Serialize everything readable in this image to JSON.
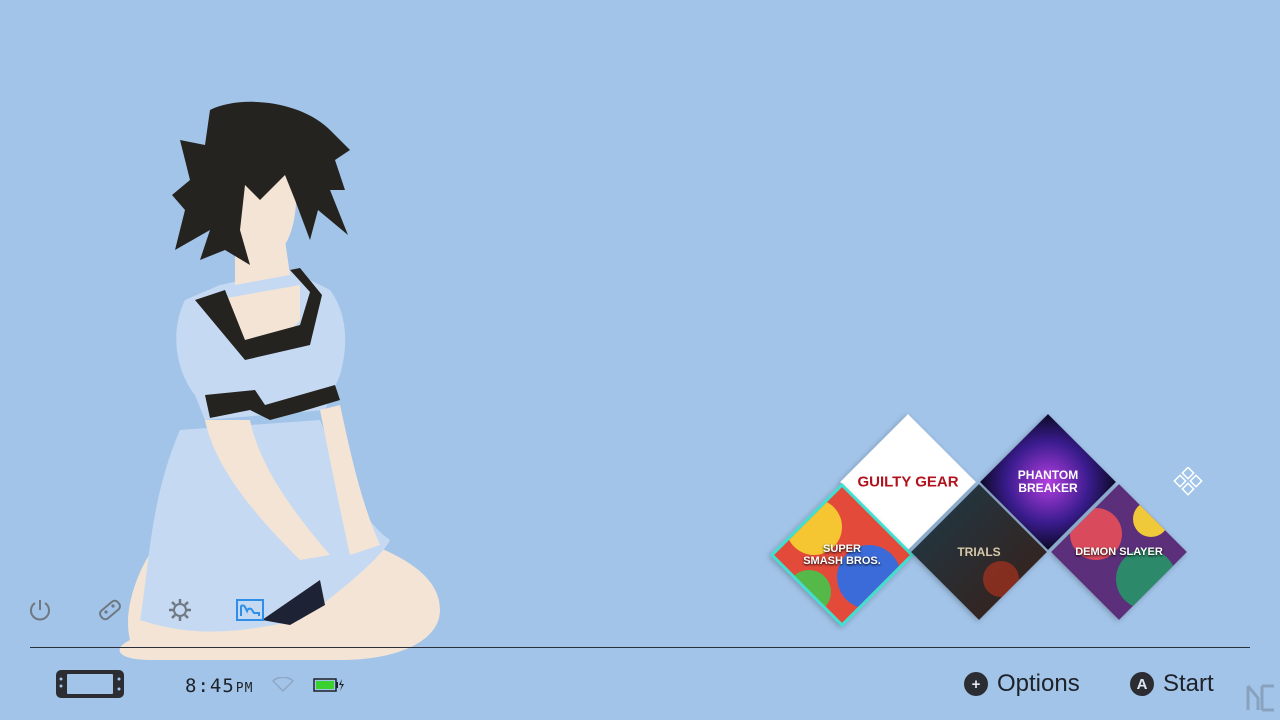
{
  "colors": {
    "background": "#a2c4e9",
    "selected_accent": "#2f8fe8",
    "selected_tile_border": "#3fe0d0",
    "battery_fill": "#39d12e"
  },
  "dock": [
    {
      "name": "power",
      "icon": "power-icon"
    },
    {
      "name": "controllers",
      "icon": "controller-icon"
    },
    {
      "name": "settings",
      "icon": "gear-icon"
    },
    {
      "name": "album",
      "icon": "album-icon",
      "selected": true
    }
  ],
  "games": [
    {
      "id": "smash",
      "label_lines": [
        "SUPER",
        "SMASH BROS."
      ],
      "selected": true
    },
    {
      "id": "guilty_gear",
      "label_lines": [
        "GUILTY GEAR"
      ]
    },
    {
      "id": "dark",
      "label_lines": [
        "TRIALS"
      ]
    },
    {
      "id": "phantom_breaker",
      "label_lines": [
        "PHANTOM",
        "BREAKER"
      ]
    },
    {
      "id": "demon_slayer",
      "label_lines": [
        "DEMON SLAYER"
      ]
    }
  ],
  "all_software_icon": "grid-diamonds-icon",
  "status": {
    "time": "8:45",
    "ampm": "PM",
    "wifi_icon": "wifi-icon",
    "battery_icon": "battery-charging-icon"
  },
  "hints": {
    "options_button": "+",
    "options_label": "Options",
    "start_button": "A",
    "start_label": "Start"
  }
}
